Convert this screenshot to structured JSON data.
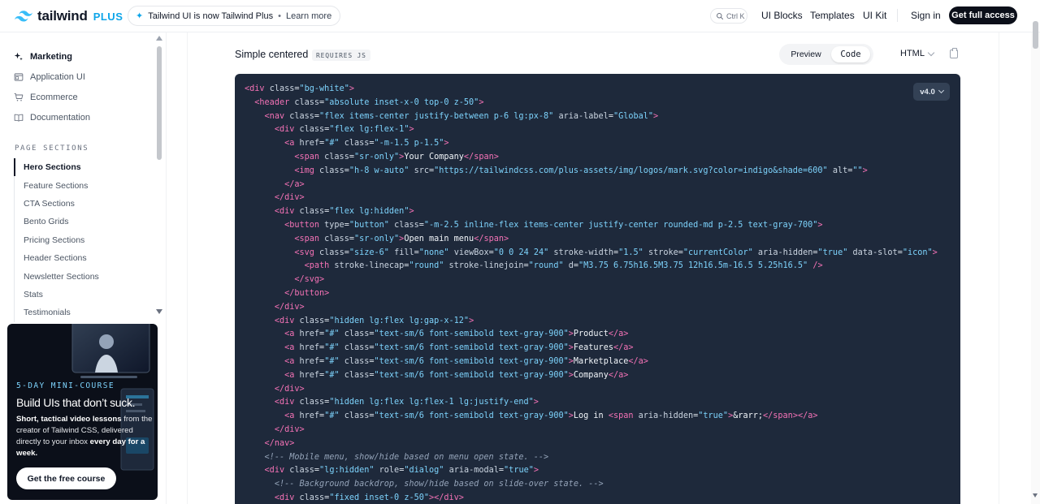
{
  "header": {
    "logo_text": "tailwind",
    "logo_plus": "PLUS",
    "announcement": {
      "text": "Tailwind UI is now Tailwind Plus",
      "separator": "•",
      "link": "Learn more"
    },
    "search_shortcut": "Ctrl K",
    "nav": [
      "UI Blocks",
      "Templates",
      "UI Kit"
    ],
    "sign_in": "Sign in",
    "cta": "Get full access"
  },
  "sidebar": {
    "main_items": [
      {
        "label": "Marketing",
        "icon": "sparkles-icon"
      },
      {
        "label": "Application UI",
        "icon": "window-icon"
      },
      {
        "label": "Ecommerce",
        "icon": "cart-icon"
      },
      {
        "label": "Documentation",
        "icon": "book-icon"
      }
    ],
    "section_heading": "PAGE SECTIONS",
    "sub_items": [
      "Hero Sections",
      "Feature Sections",
      "CTA Sections",
      "Bento Grids",
      "Pricing Sections",
      "Header Sections",
      "Newsletter Sections",
      "Stats",
      "Testimonials"
    ],
    "promo": {
      "kicker": "5-DAY MINI-COURSE",
      "title": "Build UIs that don’t suck.",
      "body_bold_start": "Short, tactical video lessons",
      "body_mid": " from the creator of Tailwind CSS, delivered directly to your inbox ",
      "body_bold_end": "every day for a week.",
      "button": "Get the free course"
    }
  },
  "main": {
    "title": "Simple centered",
    "badge": "REQUIRES JS",
    "toggle": {
      "preview": "Preview",
      "code": "Code"
    },
    "language": "HTML",
    "version": "v4.0",
    "colors": {
      "code_bg": "#1e293b",
      "tag": "#f472b6",
      "string": "#7dd3fc",
      "comment": "#94a3b8"
    },
    "code_lines": [
      "<div class=\"bg-white\">",
      "  <header class=\"absolute inset-x-0 top-0 z-50\">",
      "    <nav class=\"flex items-center justify-between p-6 lg:px-8\" aria-label=\"Global\">",
      "      <div class=\"flex lg:flex-1\">",
      "        <a href=\"#\" class=\"-m-1.5 p-1.5\">",
      "          <span class=\"sr-only\">Your Company</span>",
      "          <img class=\"h-8 w-auto\" src=\"https://tailwindcss.com/plus-assets/img/logos/mark.svg?color=indigo&shade=600\" alt=\"\">",
      "        </a>",
      "      </div>",
      "      <div class=\"flex lg:hidden\">",
      "        <button type=\"button\" class=\"-m-2.5 inline-flex items-center justify-center rounded-md p-2.5 text-gray-700\">",
      "          <span class=\"sr-only\">Open main menu</span>",
      "          <svg class=\"size-6\" fill=\"none\" viewBox=\"0 0 24 24\" stroke-width=\"1.5\" stroke=\"currentColor\" aria-hidden=\"true\" data-slot=\"icon\">",
      "            <path stroke-linecap=\"round\" stroke-linejoin=\"round\" d=\"M3.75 6.75h16.5M3.75 12h16.5m-16.5 5.25h16.5\" />",
      "          </svg>",
      "        </button>",
      "      </div>",
      "      <div class=\"hidden lg:flex lg:gap-x-12\">",
      "        <a href=\"#\" class=\"text-sm/6 font-semibold text-gray-900\">Product</a>",
      "        <a href=\"#\" class=\"text-sm/6 font-semibold text-gray-900\">Features</a>",
      "        <a href=\"#\" class=\"text-sm/6 font-semibold text-gray-900\">Marketplace</a>",
      "        <a href=\"#\" class=\"text-sm/6 font-semibold text-gray-900\">Company</a>",
      "      </div>",
      "      <div class=\"hidden lg:flex lg:flex-1 lg:justify-end\">",
      "        <a href=\"#\" class=\"text-sm/6 font-semibold text-gray-900\">Log in <span aria-hidden=\"true\">&rarr;</span></a>",
      "      </div>",
      "    </nav>",
      "    <!-- Mobile menu, show/hide based on menu open state. -->",
      "    <div class=\"lg:hidden\" role=\"dialog\" aria-modal=\"true\">",
      "      <!-- Background backdrop, show/hide based on slide-over state. -->",
      "      <div class=\"fixed inset-0 z-50\"></div>"
    ]
  }
}
